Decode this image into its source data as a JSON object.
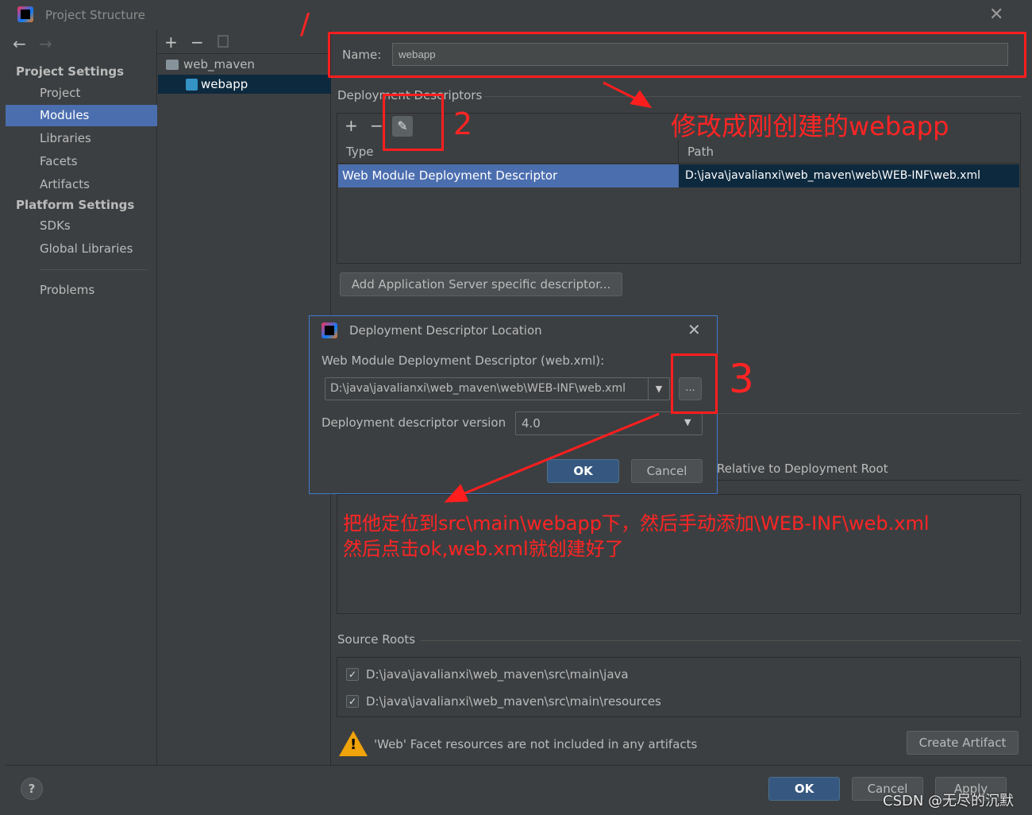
{
  "window": {
    "title": "Project Structure"
  },
  "sidebar": {
    "project_settings": "Project Settings",
    "items_project": [
      "Project",
      "Modules",
      "Libraries",
      "Facets",
      "Artifacts"
    ],
    "platform_settings": "Platform Settings",
    "items_platform": [
      "SDKs",
      "Global Libraries"
    ],
    "problems": "Problems",
    "selected": "Modules"
  },
  "module_tree": {
    "items": [
      {
        "label": "web_maven",
        "icon": "folder-icon"
      },
      {
        "label": "webapp",
        "icon": "web-module-icon",
        "selected": true
      }
    ]
  },
  "main": {
    "name_label": "Name:",
    "name_value": "webapp",
    "deployment_descriptors": "Deployment Descriptors",
    "table": {
      "headers": [
        "Type",
        "Path"
      ],
      "rows": [
        {
          "type": "Web Module Deployment Descriptor",
          "path": "D:\\java\\javalianxi\\web_maven\\web\\WEB-INF\\web.xml"
        }
      ]
    },
    "add_server_descriptor": "Add Application Server specific descriptor...",
    "relative_header": "Relative to Deployment Root",
    "source_roots": "Source Roots",
    "source_root_items": [
      {
        "path": "D:\\java\\javalianxi\\web_maven\\src\\main\\java",
        "checked": true
      },
      {
        "path": "D:\\java\\javalianxi\\web_maven\\src\\main\\resources",
        "checked": true
      }
    ],
    "warning_text": "'Web' Facet resources are not included in any artifacts",
    "create_artifact": "Create Artifact"
  },
  "footer": {
    "ok": "OK",
    "cancel": "Cancel",
    "apply": "Apply",
    "help": "?"
  },
  "dialog": {
    "title": "Deployment Descriptor Location",
    "field_label": "Web Module Deployment Descriptor (web.xml):",
    "field_value": "D:\\java\\javalianxi\\web_maven\\web\\WEB-INF\\web.xml",
    "browse": "...",
    "version_label": "Deployment descriptor version",
    "version_value": "4.0",
    "ok": "OK",
    "cancel": "Cancel"
  },
  "annotations": {
    "num1": "/",
    "num2": "2",
    "num3": "3",
    "note_rename": "修改成刚创建的webapp",
    "note_locate_line1": "把他定位到src\\main\\webapp下，然后手动添加\\WEB-INF\\web.xml",
    "note_locate_line2": "然后点击ok,web.xml就创建好了"
  },
  "watermark": "CSDN @无尽的沉默",
  "colors": {
    "accent": "#4b6eaf",
    "annotation": "#ff1e1e",
    "background": "#3c3f41"
  }
}
